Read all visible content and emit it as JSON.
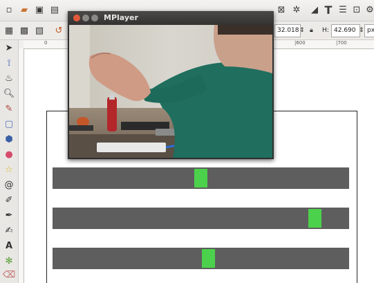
{
  "app": {
    "toolbar_icons": [
      "new-icon",
      "open-icon",
      "save-icon",
      "print-icon",
      "import-icon",
      "export-icon",
      "zoom-icon",
      "transform-icon",
      "text-tool-icon",
      "layers-icon",
      "xml-editor-icon",
      "preferences-icon"
    ],
    "text_icon_glyph": "T"
  },
  "controls": {
    "w_value": "32.018",
    "h_label": "H:",
    "h_value": "42.690",
    "unit": "px"
  },
  "ruler": {
    "ticks": [
      "0",
      "|600",
      "|700"
    ]
  },
  "mplayer": {
    "title": "MPlayer",
    "close_color": "#e25a3a",
    "min_color": "#8a8884",
    "max_color": "#8a8884"
  },
  "sliders": [
    {
      "value_fraction": 0.5
    },
    {
      "value_fraction": 0.885
    },
    {
      "value_fraction": 0.525
    }
  ],
  "colors": {
    "track": "#5e5e5e",
    "knob": "#4cd14c"
  }
}
